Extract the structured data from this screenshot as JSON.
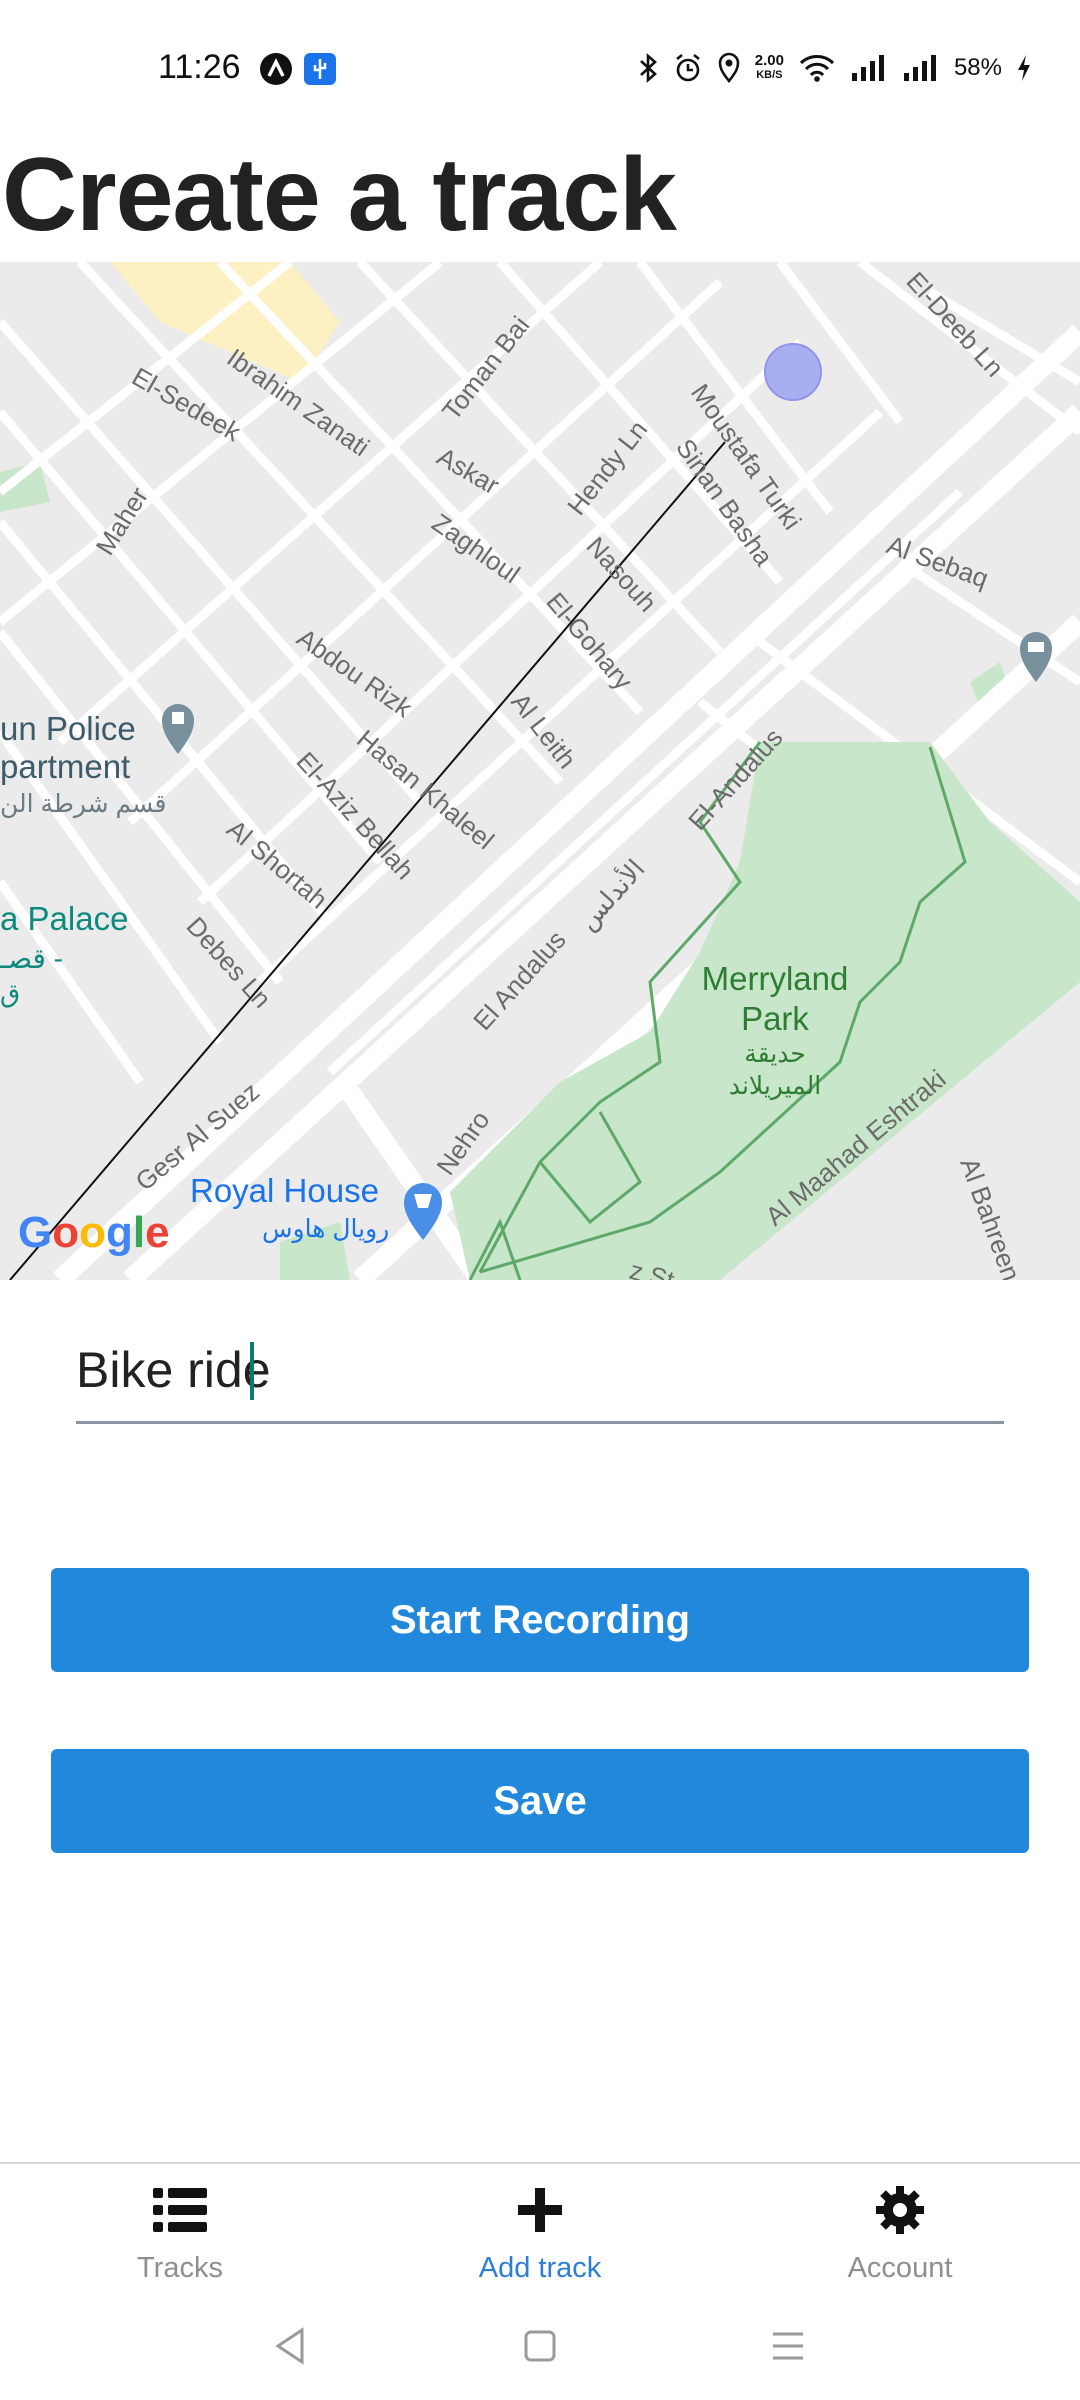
{
  "status_bar": {
    "time": "11:26",
    "net_speed_value": "2.00",
    "net_speed_unit": "KB/S",
    "battery": "58%",
    "icons": [
      "app-notification-icon",
      "usb-icon",
      "bluetooth-icon",
      "alarm-icon",
      "location-icon",
      "wifi-icon",
      "signal-icon",
      "signal-icon",
      "charging-icon"
    ]
  },
  "page": {
    "title": "Create a track"
  },
  "map": {
    "attribution": "Google",
    "street_labels": {
      "el_sedeek": "El-Sedeek",
      "ibrahim_zanati": "Ibrahim Zanati",
      "toman_bai": "Toman Bai",
      "el_deeb": "El-Deeb Ln",
      "moustafa_turki": "Moustafa Turki",
      "sinan_basha": "Sinan Basha",
      "hendy": "Hendy Ln",
      "askar": "Askar",
      "maher": "Maher",
      "zaghloul": "Zaghloul",
      "nasouh": "Nasouh",
      "el_gohary": "El-Gohary",
      "al_sebaq": "Al Sebaq",
      "abdou_rizk": "Abdou Rizk",
      "al_leith": "Al Leith",
      "hasan_khaleel": "Hasan Khaleel",
      "el_aziz_bellah": "El-Aziz Bellah",
      "el_andalus": "El-Andalus",
      "al_shortah": "Al Shortah",
      "el_andalus_ar": "الأندلس",
      "debes": "Debes Ln",
      "el_andalus_2": "El Andalus",
      "gesr_al_suez": "Gesr Al Suez",
      "nehro": "Nehro",
      "al_maahad_eshtraki": "Al Maahad Eshtraki",
      "al_bahreen": "Al Bahreen",
      "z_st": "z St"
    },
    "place_labels": {
      "police_line1": "un Police",
      "police_line2": "partment",
      "police_ar": "قسم شرطة الن",
      "palace_line1": "a Palace",
      "palace_line2": "قصـ -",
      "palace_line3": "ق",
      "park_line1": "Merryland",
      "park_line2": "Park",
      "park_ar1": "حديقة",
      "park_ar2": "الميريلاند",
      "royal_house": "Royal House",
      "royal_house_ar": "رويال هاوس"
    }
  },
  "form": {
    "track_name_value": "Bike ride",
    "start_button": "Start Recording",
    "save_button": "Save"
  },
  "tabs": [
    {
      "label": "Tracks",
      "icon": "list-icon",
      "active": false
    },
    {
      "label": "Add track",
      "icon": "plus-icon",
      "active": true
    },
    {
      "label": "Account",
      "icon": "gear-icon",
      "active": false
    }
  ],
  "system_nav": [
    "back-icon",
    "home-icon",
    "menu-icon"
  ],
  "colors": {
    "primary": "#2288db",
    "active_tab": "#2d7fd6",
    "inactive_tab": "#8e8e93",
    "park": "#c8e6c9",
    "location_dot": "#a9aef0"
  }
}
